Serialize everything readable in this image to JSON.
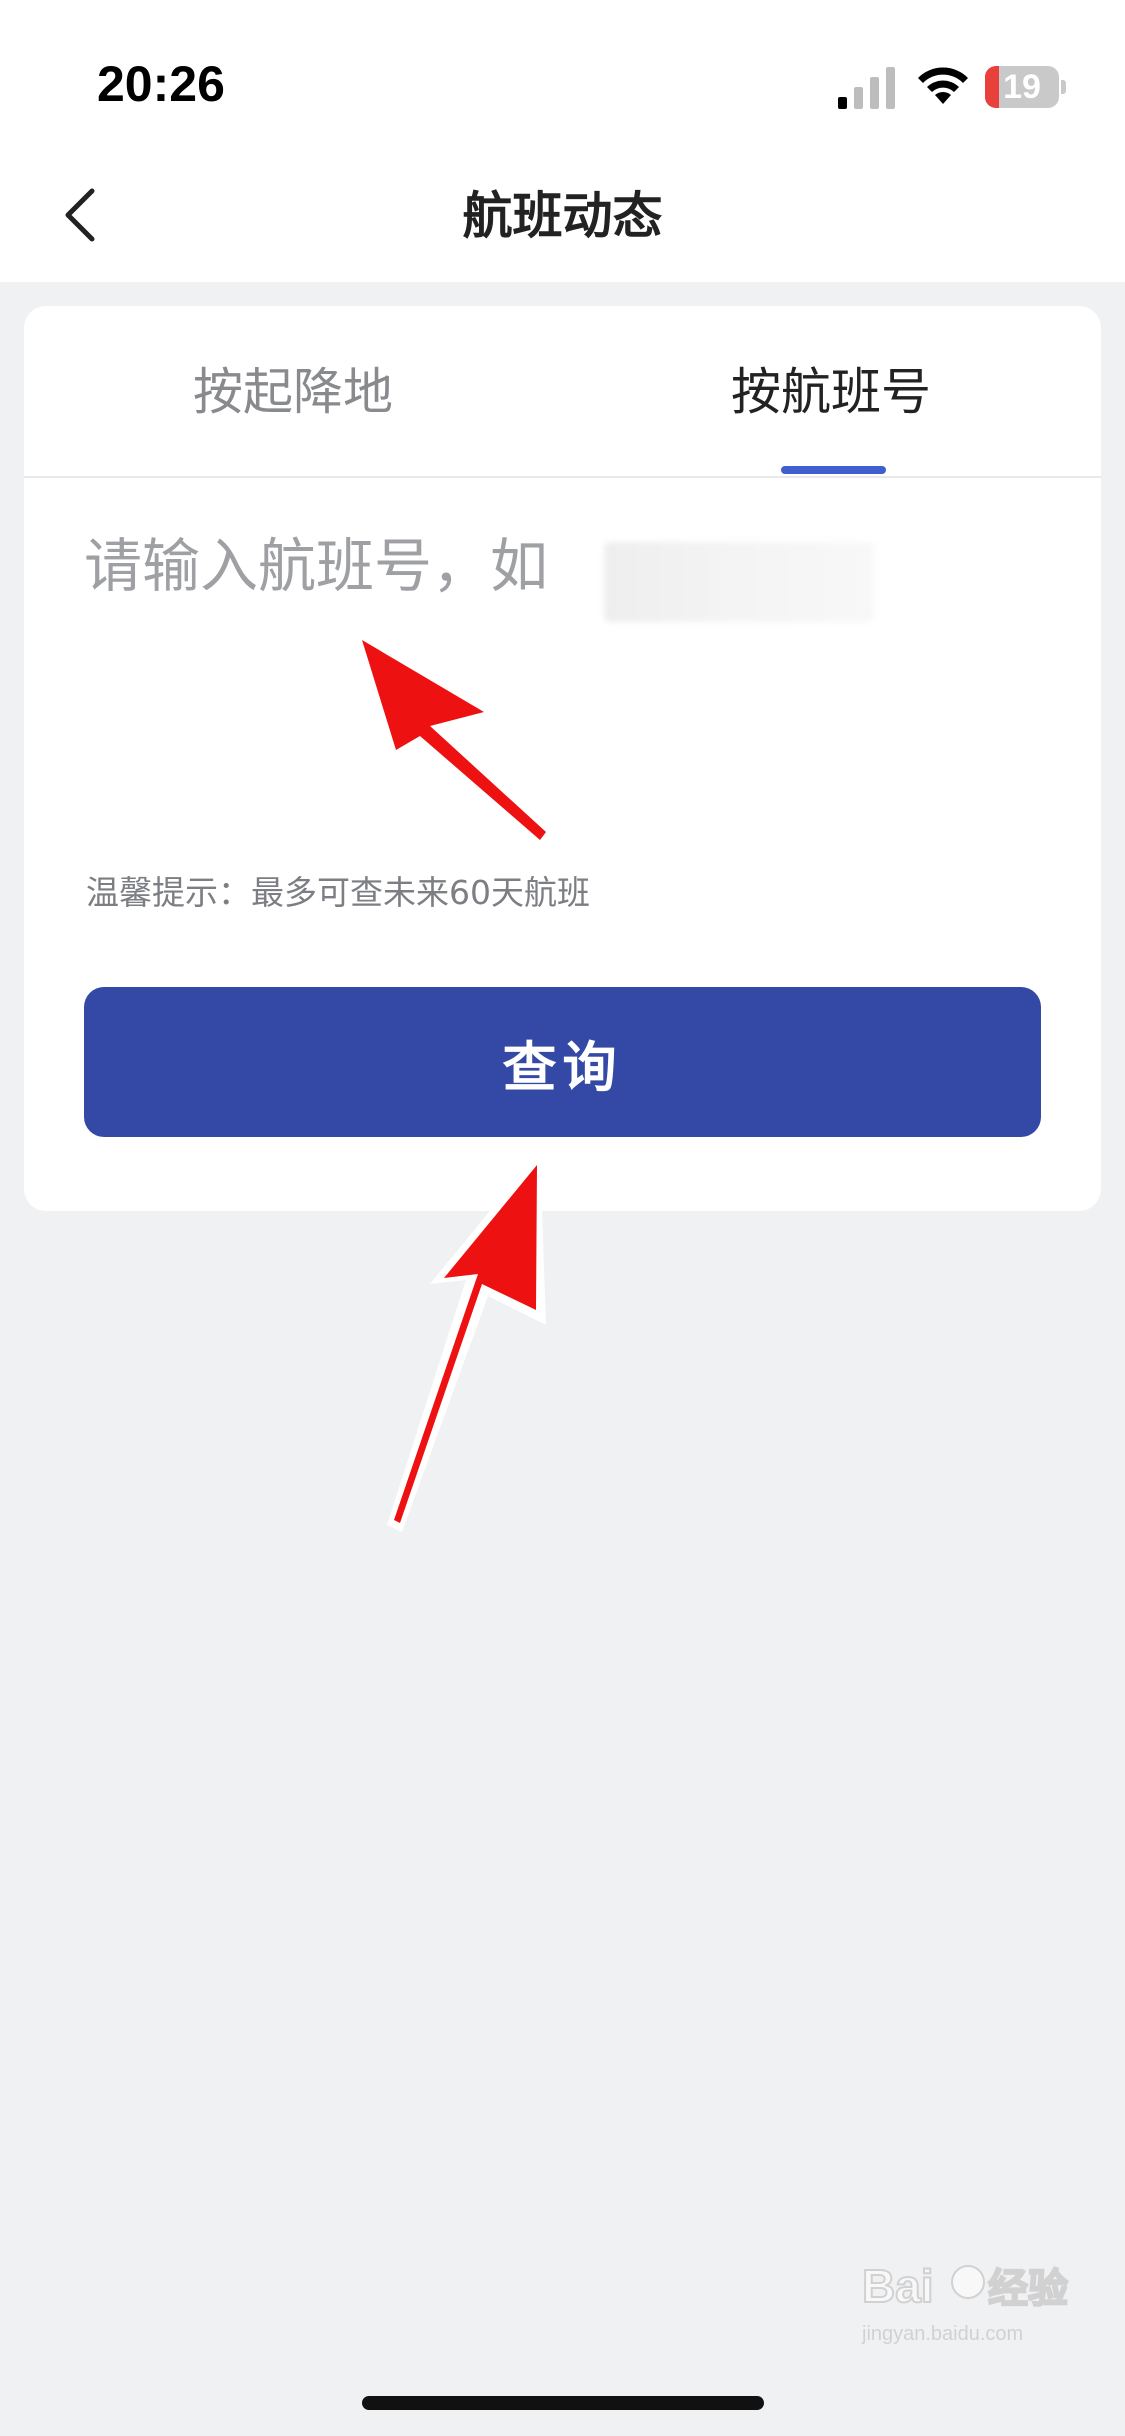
{
  "status_bar": {
    "time": "20:26",
    "battery_level": "19",
    "battery_color": "#e8403a",
    "icons": [
      "signal-icon",
      "wifi-icon",
      "battery-icon"
    ]
  },
  "nav": {
    "back_icon": "chevron-left-icon",
    "title": "航班动态"
  },
  "tabs": {
    "items": [
      {
        "label": "按起降地",
        "active": false
      },
      {
        "label": "按航班号",
        "active": true
      }
    ],
    "accent_color": "#3f5fcf"
  },
  "search": {
    "placeholder": "请输入航班号，如",
    "value": ""
  },
  "tip": "温馨提示：最多可查未来60天航班",
  "query_button": {
    "label": "查询",
    "color": "#3349a5"
  },
  "watermark": {
    "text": "Baidu经验",
    "subtext": "jingyan.baidu.com"
  }
}
